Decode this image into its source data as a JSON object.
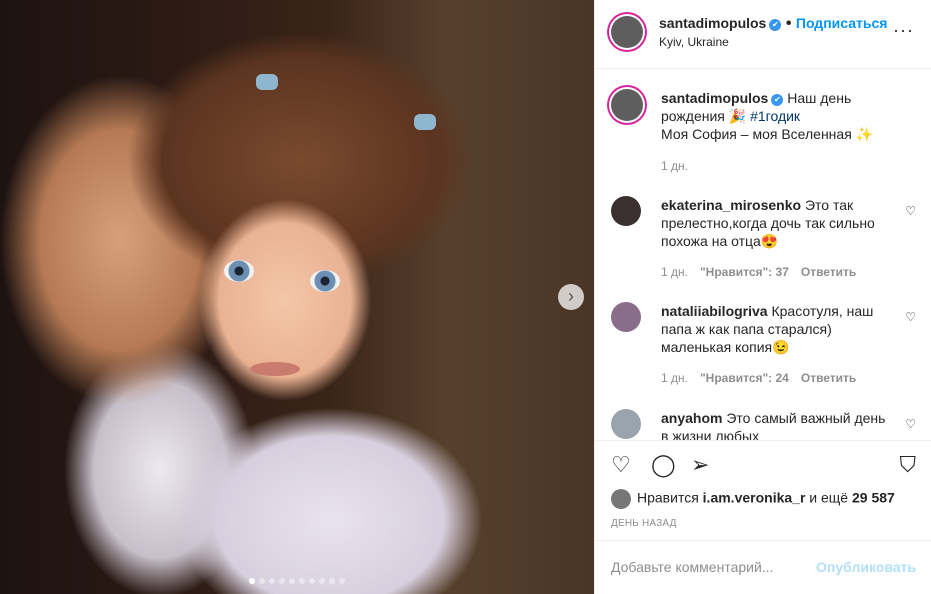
{
  "post": {
    "username": "santadimopulos",
    "follow_label": "Подписаться",
    "separator": "•",
    "location": "Kyiv, Ukraine",
    "more_icon": "more-icon",
    "verified_icon": "✔",
    "caption_text": " Наш день рождения 🎉 ",
    "caption_hashtag": "#1годик",
    "caption_line2": "Моя София – моя Вселенная ✨",
    "caption_time": "1 дн."
  },
  "comments": [
    {
      "username": "ekaterina_mirosenko",
      "text": " Это так прелестно,когда дочь так сильно похожа на отца😍",
      "time": "1 дн.",
      "likes": "\"Нравится\": 37",
      "reply": "Ответить"
    },
    {
      "username": "nataliiabilogriva",
      "text": " Красотуля, наш папа ж как папа старался) маленькая копия😉",
      "time": "1 дн.",
      "likes": "\"Нравится\": 24",
      "reply": "Ответить"
    },
    {
      "username": "anyahom",
      "text": " Это самый важный день в жизни любых",
      "time": "",
      "likes": "",
      "reply": ""
    }
  ],
  "likes": {
    "prefix": "Нравится ",
    "user": "i.am.veronika_r",
    "connector": " и ещё ",
    "count": "29 587"
  },
  "date": "ДЕНЬ НАЗАД",
  "add_comment": {
    "placeholder": "Добавьте комментарий...",
    "publish_label": "Опубликовать"
  },
  "carousel": {
    "slides": 10,
    "active": 1
  }
}
